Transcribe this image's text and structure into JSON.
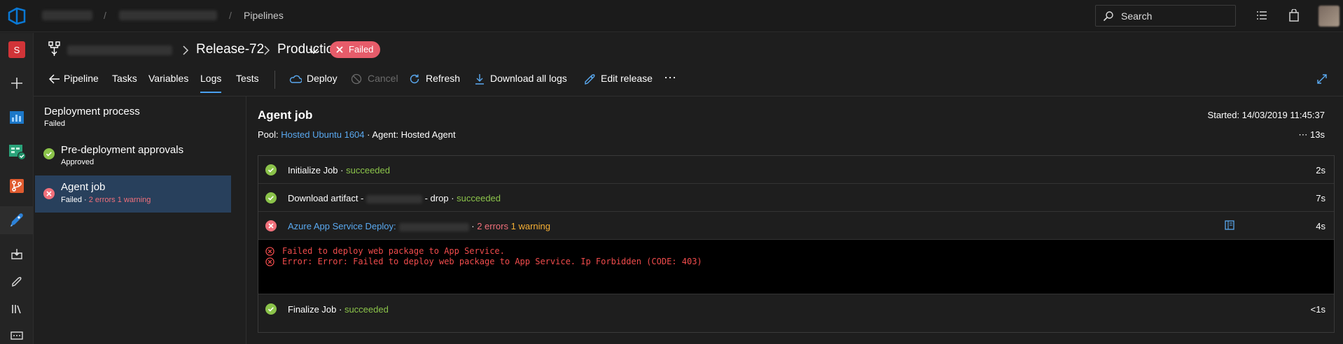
{
  "topbar": {
    "breadcrumb_current": "Pipelines",
    "search_label": "Search",
    "icons": [
      "azure-devops-logo",
      "list-icon",
      "shopping-bag-icon",
      "avatar"
    ]
  },
  "leftnav": {
    "project_initial": "S",
    "items": [
      "new-item",
      "boards",
      "repos",
      "pipelines",
      "test-plans",
      "artifacts",
      "releases",
      "library",
      "task-groups"
    ]
  },
  "release": {
    "name": "Release-72",
    "stage": "Production",
    "status": "Failed"
  },
  "tabs": [
    {
      "label": "Pipeline"
    },
    {
      "label": "Tasks"
    },
    {
      "label": "Variables"
    },
    {
      "label": "Logs",
      "active": true
    },
    {
      "label": "Tests"
    }
  ],
  "commands": {
    "deploy": "Deploy",
    "cancel": "Cancel",
    "refresh": "Refresh",
    "download": "Download all logs",
    "edit": "Edit release",
    "more": "⋯"
  },
  "stages": {
    "process_title": "Deployment process",
    "process_status": "Failed",
    "approvals_title": "Pre-deployment approvals",
    "approvals_status": "Approved",
    "agent_title": "Agent job",
    "agent_status": "Failed",
    "agent_errors": "2 errors 1 warning"
  },
  "job": {
    "title": "Agent job",
    "pool_label": "Pool:",
    "pool_value": "Hosted Ubuntu 1604",
    "agent_label": " · Agent: Hosted Agent",
    "started": "Started: 14/03/2019 11:45:37",
    "duration": "⋯ 13s"
  },
  "tasks": [
    {
      "name": "Initialize Job",
      "status": "succeeded",
      "duration": "2s"
    },
    {
      "name_prefix": "Download artifact - ",
      "name_suffix": " - drop",
      "status": "succeeded",
      "duration": "7s"
    },
    {
      "name": "Azure App Service Deploy:",
      "errors": "2 errors",
      "warnings": "1 warning",
      "duration": "4s"
    },
    {
      "name": "Finalize Job",
      "status": "succeeded",
      "duration": "<1s"
    }
  ],
  "console_lines": [
    "Failed to deploy web package to App Service.",
    "Error: Error: Failed to deploy web package to App Service. Ip Forbidden (CODE: 403)"
  ],
  "colors": {
    "success": "#8bc34a",
    "error": "#f1707b",
    "warning": "#f7b035",
    "link": "#5aa9f0",
    "selected": "#28405c"
  }
}
